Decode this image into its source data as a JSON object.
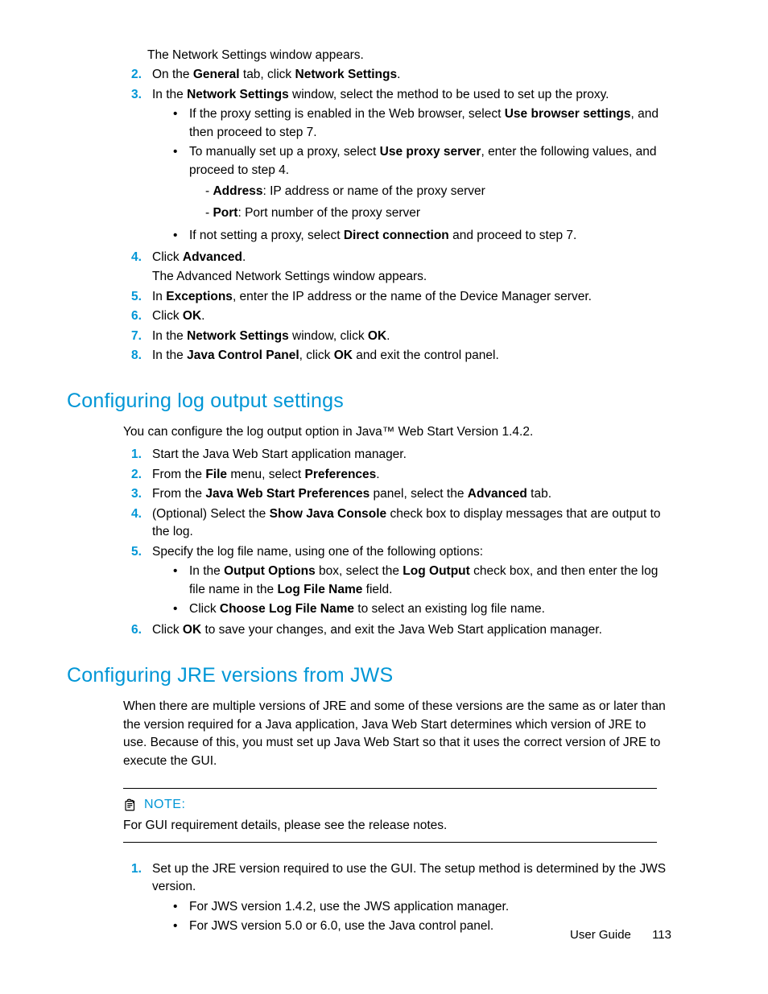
{
  "intro_line": "The Network Settings window appears.",
  "sec1": {
    "steps": [
      {
        "n": "2.",
        "pre": "On the ",
        "b1": "General",
        "mid": " tab, click ",
        "b2": "Network Settings",
        "post": "."
      },
      {
        "n": "3.",
        "pre": "In the ",
        "b1": "Network Settings",
        "post": " window, select the method to be used to set up the proxy.",
        "bullets": [
          {
            "pre": "If the proxy setting is enabled in the Web browser, select ",
            "b1": "Use browser settings",
            "post": ", and then proceed to step 7."
          },
          {
            "pre": "To manually set up a proxy, select ",
            "b1": "Use proxy server",
            "post": ", enter the following values, and proceed to step 4.",
            "subs": [
              {
                "dash": "- ",
                "b": "Address",
                "rest": ": IP address or name of the proxy server"
              },
              {
                "dash": "- ",
                "b": "Port",
                "rest": ": Port number of the proxy server"
              }
            ]
          },
          {
            "pre": "If not setting a proxy, select ",
            "b1": "Direct connection",
            "post": " and proceed to step 7."
          }
        ]
      },
      {
        "n": "4.",
        "pre": "Click ",
        "b1": "Advanced",
        "post": ".",
        "extra": "The Advanced Network Settings window appears."
      },
      {
        "n": "5.",
        "pre": "In ",
        "b1": "Exceptions",
        "post": ", enter the IP address or the name of the Device Manager server."
      },
      {
        "n": "6.",
        "pre": "Click ",
        "b1": "OK",
        "post": "."
      },
      {
        "n": "7.",
        "pre": "In the ",
        "b1": "Network Settings",
        "mid": " window, click ",
        "b2": "OK",
        "post": "."
      },
      {
        "n": "8.",
        "pre": "In the ",
        "b1": "Java Control Panel",
        "mid": ", click ",
        "b2": "OK",
        "post": " and exit the control panel."
      }
    ]
  },
  "h2a": "Configuring log output settings",
  "h2a_intro": "You can configure the log output option in Java™ Web Start Version 1.4.2.",
  "sec2": {
    "steps": [
      {
        "n": "1.",
        "plain": "Start the Java Web Start application manager."
      },
      {
        "n": "2.",
        "pre": "From the ",
        "b1": "File",
        "mid": " menu, select ",
        "b2": "Preferences",
        "post": "."
      },
      {
        "n": "3.",
        "pre": "From the ",
        "b1": "Java Web Start Preferences",
        "mid": " panel, select the ",
        "b2": "Advanced",
        "post": " tab."
      },
      {
        "n": "4.",
        "pre": "(Optional) Select the ",
        "b1": "Show Java Console",
        "post": " check box to display messages that are output to the log."
      },
      {
        "n": "5.",
        "plain": "Specify the log file name, using one of the following options:",
        "bullets": [
          {
            "pre": "In the ",
            "b1": "Output Options",
            "mid": " box, select the ",
            "b2": "Log Output",
            "mid2": " check box, and then enter the log file name in the ",
            "b3": "Log File Name",
            "post": " field."
          },
          {
            "pre": "Click ",
            "b1": "Choose Log File Name",
            "post": " to select an existing log file name."
          }
        ]
      },
      {
        "n": "6.",
        "pre": "Click ",
        "b1": "OK",
        "post": " to save your changes, and exit the Java Web Start application manager."
      }
    ]
  },
  "h2b": "Configuring JRE versions from JWS",
  "h2b_intro": "When there are multiple versions of JRE and some of these versions are the same as or later than the version required for a Java application, Java Web Start determines which version of JRE to use. Because of this, you must set up Java Web Start so that it uses the correct version of JRE to execute the GUI.",
  "note_label": "NOTE:",
  "note_text": "For GUI requirement details, please see the release notes.",
  "sec3": {
    "steps": [
      {
        "n": "1.",
        "plain": "Set up the JRE version required to use the GUI. The setup method is determined by the JWS version.",
        "bullets": [
          {
            "plain": "For JWS version 1.4.2, use the JWS application manager."
          },
          {
            "plain": "For JWS version 5.0 or 6.0, use the Java control panel."
          }
        ]
      }
    ]
  },
  "footer_label": "User Guide",
  "footer_page": "113"
}
